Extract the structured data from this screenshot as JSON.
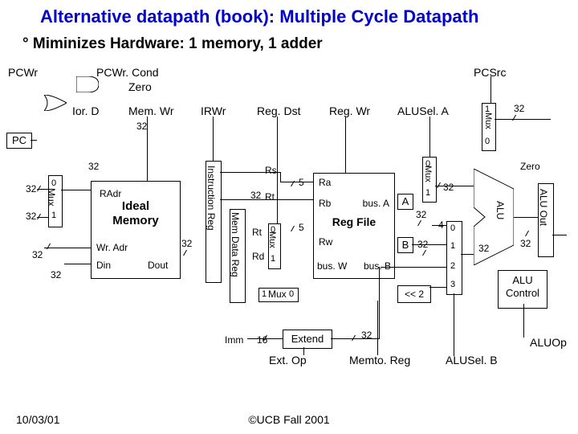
{
  "title": "Alternative datapath (book): Multiple Cycle Datapath",
  "subtitle": "° Miminizes Hardware: 1 memory, 1 adder",
  "signals": {
    "pcwr": "PCWr",
    "pcwrcond": "PCWr. Cond",
    "zero": "Zero",
    "iord": "Ior. D",
    "memwr": "Mem. Wr",
    "irwr": "IRWr",
    "regdst": "Reg. Dst",
    "regwr": "Reg. Wr",
    "pcsrc": "PCSrc",
    "aluselA": "ALUSel. A",
    "aluselB": "ALUSel. B",
    "aluop": "ALUOp",
    "extop": "Ext. Op",
    "memtoreg": "Memto. Reg"
  },
  "blocks": {
    "pc": "PC",
    "radr": "RAdr",
    "ideal_memory": "Ideal Memory",
    "wradr": "Wr. Adr",
    "din": "Din",
    "dout": "Dout",
    "instr_reg": "Instruction Reg",
    "mem_data_reg": "Mem Data Reg",
    "reg_file": "Reg File",
    "ra": "Ra",
    "rb": "Rb",
    "rw": "Rw",
    "busA": "bus. A",
    "busW": "bus. W",
    "busB": "bus. B",
    "extend": "Extend",
    "shift": "<< 2",
    "alu": "ALU",
    "alu_out": "ALU Out",
    "alu_control": "ALU Control",
    "mux": "Mux",
    "a_reg": "A",
    "b_reg": "B"
  },
  "fields": {
    "rs": "Rs",
    "rt": "Rt",
    "rt2": "Rt",
    "rd": "Rd",
    "imm": "Imm"
  },
  "widths": {
    "w32": "32",
    "w16": "16",
    "w5": "5",
    "w4": "4"
  },
  "muxsel": {
    "m0": "0",
    "m1": "1",
    "m2": "2",
    "m3": "3"
  },
  "zero_out": "Zero",
  "footer": {
    "date": "10/03/01",
    "copy": "©UCB Fall 2001"
  }
}
